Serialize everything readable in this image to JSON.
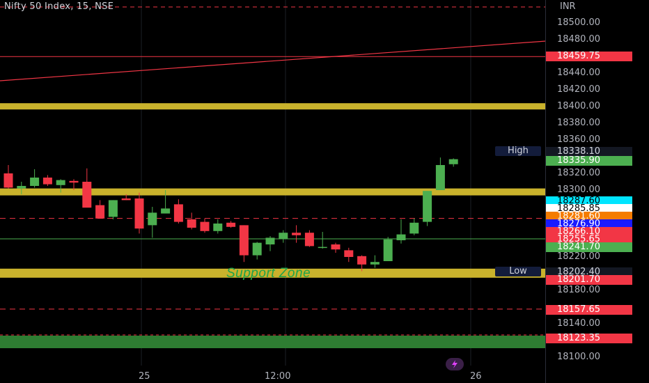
{
  "header": {
    "title": "Nifty 50 Index, 15, NSE",
    "currency": "INR"
  },
  "time_axis": {
    "labels": [
      "25",
      "12:00",
      "26"
    ]
  },
  "price_axis": {
    "labels": [
      "18500.00",
      "18480.00",
      "18440.00",
      "18420.00",
      "18400.00",
      "18380.00",
      "18360.00",
      "18320.00",
      "18300.00",
      "18220.00",
      "18180.00",
      "18140.00",
      "18100.00"
    ]
  },
  "price_tags": [
    {
      "value": "18459.75",
      "bg": "#f23645",
      "fg": "#ffffff"
    },
    {
      "value": "18338.10",
      "bg": "#131722",
      "fg": "#d1d4dc"
    },
    {
      "value": "18335.90",
      "bg": "#4caf50",
      "fg": "#ffffff"
    },
    {
      "value": "18287.60",
      "bg": "#00e5ff",
      "fg": "#000000"
    },
    {
      "value": "18285.85",
      "bg": "#ffffff",
      "fg": "#000000"
    },
    {
      "value": "18281.60",
      "bg": "#f57c00",
      "fg": "#ffffff"
    },
    {
      "value": "18276.90",
      "bg": "#1a1aff",
      "fg": "#ffffff"
    },
    {
      "value": "18266.10",
      "bg": "#f23645",
      "fg": "#ffffff"
    },
    {
      "value": "18255.65",
      "bg": "#f23645",
      "fg": "#ffffff"
    },
    {
      "value": "18241.70",
      "bg": "#4caf50",
      "fg": "#ffffff"
    },
    {
      "value": "18202.40",
      "bg": "#131722",
      "fg": "#d1d4dc"
    },
    {
      "value": "18201.70",
      "bg": "#f23645",
      "fg": "#ffffff"
    },
    {
      "value": "18157.65",
      "bg": "#f23645",
      "fg": "#ffffff"
    },
    {
      "value": "18123.35",
      "bg": "#f23645",
      "fg": "#ffffff"
    }
  ],
  "tags": {
    "high": "High",
    "low": "Low"
  },
  "annotations": {
    "support": "Support Zone"
  },
  "colors": {
    "up": "#4caf50",
    "down": "#f23645",
    "zone": "#c9b22c",
    "background": "#000000"
  },
  "chart_data": {
    "type": "candlestick",
    "ylim": [
      18090,
      18520
    ],
    "candles": [
      {
        "o": 18320,
        "h": 18330,
        "l": 18302,
        "c": 18303
      },
      {
        "o": 18302,
        "h": 18310,
        "l": 18295,
        "c": 18305
      },
      {
        "o": 18305,
        "h": 18325,
        "l": 18303,
        "c": 18315
      },
      {
        "o": 18315,
        "h": 18318,
        "l": 18305,
        "c": 18307
      },
      {
        "o": 18306,
        "h": 18313,
        "l": 18297,
        "c": 18312
      },
      {
        "o": 18311,
        "h": 18313,
        "l": 18300,
        "c": 18309
      },
      {
        "o": 18310,
        "h": 18326,
        "l": 18287,
        "c": 18279
      },
      {
        "o": 18282,
        "h": 18288,
        "l": 18268,
        "c": 18266
      },
      {
        "o": 18268,
        "h": 18288,
        "l": 18265,
        "c": 18288
      },
      {
        "o": 18290,
        "h": 18295,
        "l": 18288,
        "c": 18288
      },
      {
        "o": 18290,
        "h": 18297,
        "l": 18248,
        "c": 18254
      },
      {
        "o": 18258,
        "h": 18280,
        "l": 18243,
        "c": 18273
      },
      {
        "o": 18272,
        "h": 18300,
        "l": 18278,
        "c": 18278
      },
      {
        "o": 18283,
        "h": 18289,
        "l": 18260,
        "c": 18262
      },
      {
        "o": 18265,
        "h": 18273,
        "l": 18253,
        "c": 18255
      },
      {
        "o": 18262,
        "h": 18266,
        "l": 18249,
        "c": 18251
      },
      {
        "o": 18251,
        "h": 18265,
        "l": 18248,
        "c": 18260
      },
      {
        "o": 18261,
        "h": 18263,
        "l": 18255,
        "c": 18256
      },
      {
        "o": 18258,
        "h": 18258,
        "l": 18214,
        "c": 18222
      },
      {
        "o": 18222,
        "h": 18238,
        "l": 18217,
        "c": 18237
      },
      {
        "o": 18235,
        "h": 18245,
        "l": 18227,
        "c": 18243
      },
      {
        "o": 18242,
        "h": 18252,
        "l": 18237,
        "c": 18249
      },
      {
        "o": 18249,
        "h": 18258,
        "l": 18237,
        "c": 18246
      },
      {
        "o": 18249,
        "h": 18252,
        "l": 18232,
        "c": 18233
      },
      {
        "o": 18232,
        "h": 18250,
        "l": 18230,
        "c": 18232
      },
      {
        "o": 18235,
        "h": 18237,
        "l": 18225,
        "c": 18229
      },
      {
        "o": 18228,
        "h": 18231,
        "l": 18214,
        "c": 18220
      },
      {
        "o": 18221,
        "h": 18222,
        "l": 18203,
        "c": 18211
      },
      {
        "o": 18211,
        "h": 18222,
        "l": 18207,
        "c": 18214
      },
      {
        "o": 18215,
        "h": 18244,
        "l": 18215,
        "c": 18241
      },
      {
        "o": 18240,
        "h": 18265,
        "l": 18236,
        "c": 18247
      },
      {
        "o": 18248,
        "h": 18266,
        "l": 18246,
        "c": 18261
      },
      {
        "o": 18262,
        "h": 18299,
        "l": 18257,
        "c": 18299
      },
      {
        "o": 18300,
        "h": 18339,
        "l": 18300,
        "c": 18330
      },
      {
        "o": 18331,
        "h": 18338,
        "l": 18328,
        "c": 18337
      }
    ],
    "lines": [
      {
        "price": 18459.75,
        "color": "#f23645",
        "style": "solid"
      },
      {
        "price": 18266.1,
        "color": "#f23645",
        "style": "dashed"
      },
      {
        "price": 18241.7,
        "color": "#4caf50",
        "style": "solid"
      },
      {
        "price": 18157.65,
        "color": "#f23645",
        "style": "dashed"
      }
    ]
  }
}
